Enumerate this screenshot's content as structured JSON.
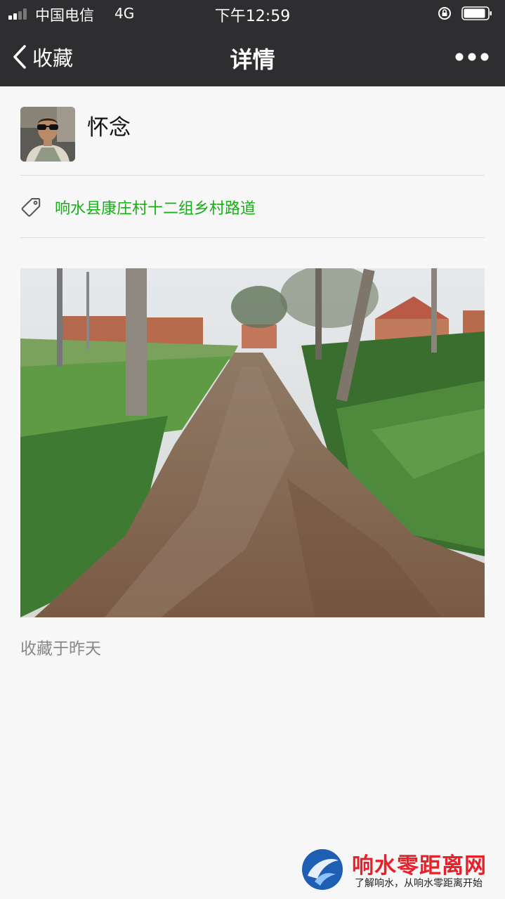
{
  "status_bar": {
    "carrier": "中国电信",
    "network": "4G",
    "time": "下午12:59"
  },
  "nav": {
    "back_label": "收藏",
    "title": "详情"
  },
  "author": {
    "name": "怀念"
  },
  "tag": {
    "text": "响水县康庄村十二组乡村路道"
  },
  "footer": {
    "saved_text": "收藏于昨天"
  },
  "watermark": {
    "title": "响水零距离网",
    "subtitle": "了解响水，从响水零距离开始"
  },
  "colors": {
    "bar_bg": "#2e2e30",
    "tag_green": "#1aad19",
    "watermark_red": "#e8202a"
  }
}
